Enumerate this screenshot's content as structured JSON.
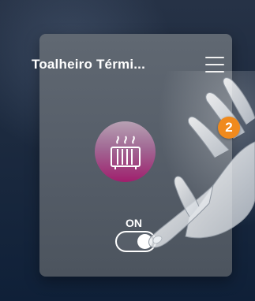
{
  "header": {
    "title": "Toalheiro Térmi..."
  },
  "device": {
    "icon": "radiator-icon",
    "accent_color": "#a01f6d"
  },
  "toggle": {
    "label": "ON",
    "state": "on"
  },
  "step_badge": {
    "number": "2",
    "color": "#f08a1d"
  },
  "icons": {
    "menu": "hamburger-menu-icon",
    "pointer": "pointing-hand-icon"
  }
}
